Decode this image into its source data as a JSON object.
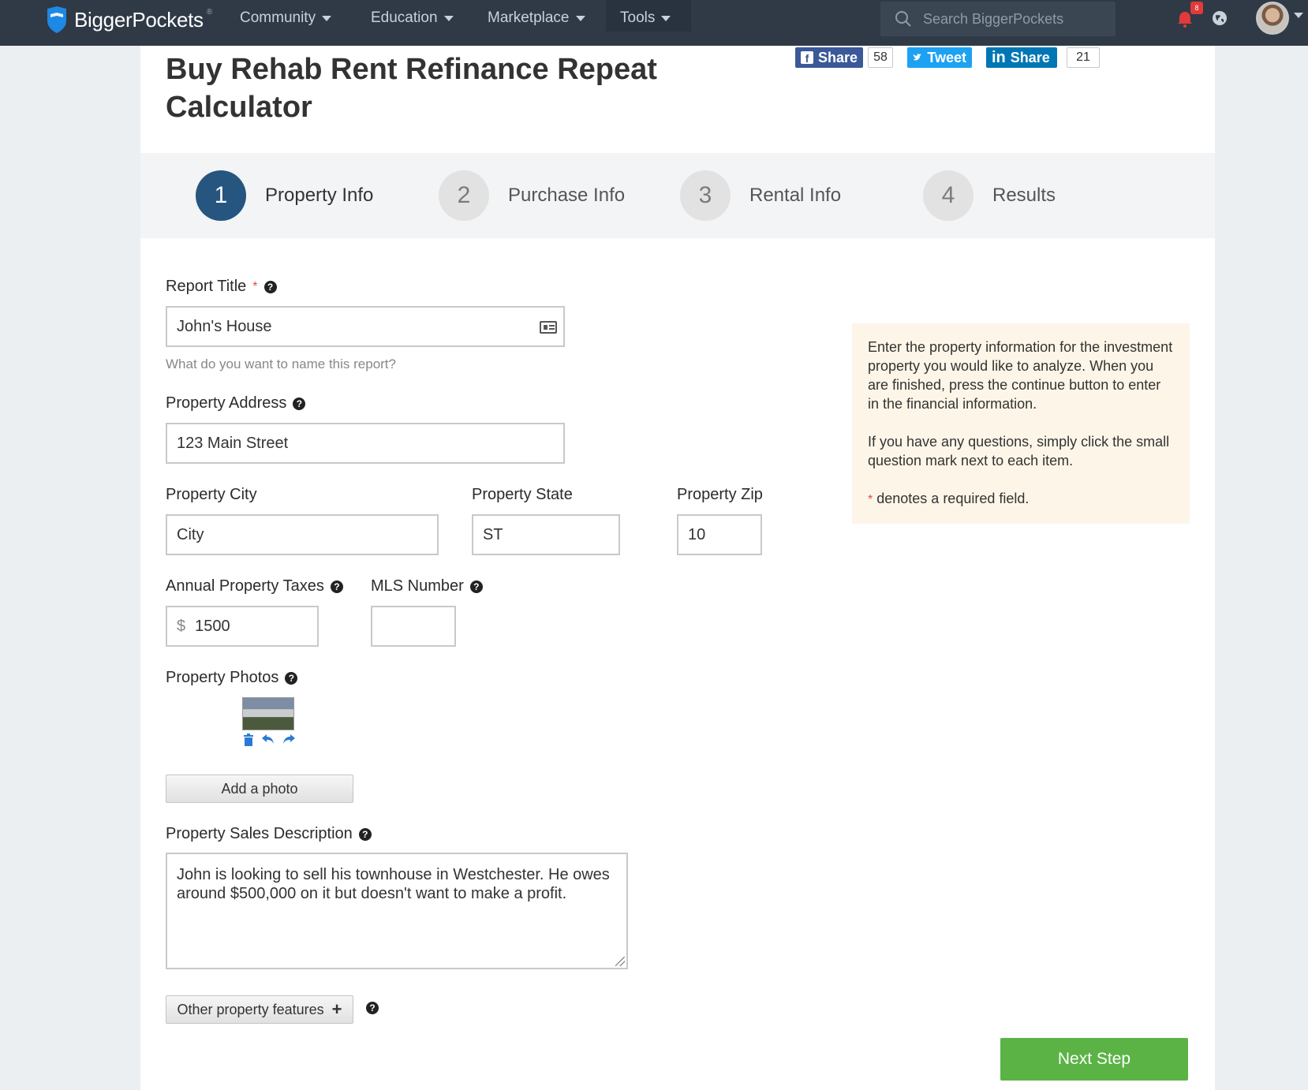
{
  "nav": {
    "brand": "BiggerPockets",
    "brand_mark": "®",
    "items": [
      {
        "label": "Community"
      },
      {
        "label": "Education"
      },
      {
        "label": "Marketplace"
      },
      {
        "label": "Tools"
      }
    ],
    "search_placeholder": "Search BiggerPockets",
    "notification_count": "8",
    "icons": [
      "search-icon",
      "bell-icon",
      "globe-icon",
      "avatar"
    ]
  },
  "page": {
    "title": "Buy Rehab Rent Refinance Repeat Calculator"
  },
  "social": {
    "facebook_label": "Share",
    "facebook_count": "58",
    "twitter_label": "Tweet",
    "linkedin_label": "Share",
    "linkedin_count": "21"
  },
  "steps": [
    {
      "number": "1",
      "label": "Property Info",
      "active": true
    },
    {
      "number": "2",
      "label": "Purchase Info",
      "active": false
    },
    {
      "number": "3",
      "label": "Rental Info",
      "active": false
    },
    {
      "number": "4",
      "label": "Results",
      "active": false
    }
  ],
  "form": {
    "report_title": {
      "label": "Report Title",
      "required_mark": "*",
      "value": "John's House",
      "hint": "What do you want to name this report?"
    },
    "address": {
      "label": "Property Address",
      "value": "123 Main Street"
    },
    "city": {
      "label": "Property City",
      "value": "City"
    },
    "state": {
      "label": "Property State",
      "value": "ST"
    },
    "zip": {
      "label": "Property Zip",
      "value": "10"
    },
    "taxes": {
      "label": "Annual Property Taxes",
      "prefix": "$",
      "value": "1500"
    },
    "mls": {
      "label": "MLS Number",
      "value": ""
    },
    "photos": {
      "label": "Property Photos",
      "add_label": "Add a photo"
    },
    "description": {
      "label": "Property Sales Description",
      "value": "John is looking to sell his townhouse in Westchester. He owes around $500,000 on it but doesn't want to make a profit."
    },
    "other_features_label": "Other property features",
    "help_glyph": "?"
  },
  "info": {
    "p1": "Enter the property information for the investment property you would like to analyze. When you are finished, press the continue button to enter in the financial information.",
    "p2": "If you have any questions, simply click the small question mark next to each item.",
    "p3_mark": "*",
    "p3": "denotes a required field."
  },
  "actions": {
    "next_label": "Next Step"
  },
  "colors": {
    "nav_bg": "#2f3a46",
    "active_step": "#26557f",
    "next_button": "#5bb346",
    "info_bg": "#fdf6e8",
    "facebook": "#3b5998",
    "twitter": "#1da1f2",
    "linkedin": "#0077b5"
  }
}
